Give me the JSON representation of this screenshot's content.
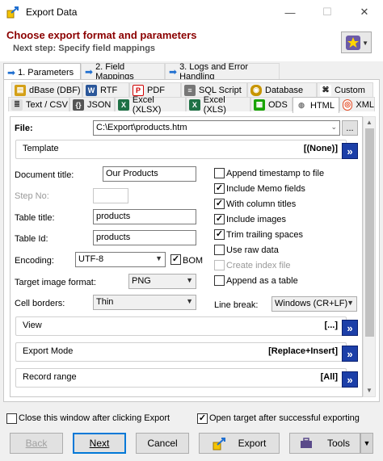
{
  "window": {
    "title": "Export Data",
    "minimize": "—",
    "maximize": "☐",
    "close": "✕"
  },
  "header": {
    "title": "Choose export format and parameters",
    "subtitle": "Next step: Specify field mappings"
  },
  "main_tabs": [
    {
      "label": "1. Parameters"
    },
    {
      "label": "2. Field Mappings"
    },
    {
      "label": "3. Logs and Error Handling"
    }
  ],
  "format_tabs_row1": [
    "dBase (DBF)",
    "RTF",
    "PDF",
    "SQL Script",
    "Database",
    "Custom"
  ],
  "format_tabs_row2": [
    "Text / CSV",
    "JSON",
    "Excel (XLSX)",
    "Excel (XLS)",
    "ODS",
    "HTML",
    "XML"
  ],
  "file": {
    "label": "File:",
    "value": "C:\\Export\\products.htm",
    "browse": "..."
  },
  "template": {
    "label": "Template",
    "value": "[(None)]"
  },
  "fields": {
    "document_title": {
      "label": "Document title:",
      "value": "Our Products"
    },
    "step_no": {
      "label": "Step No:",
      "value": ""
    },
    "table_title": {
      "label": "Table title:",
      "value": "products"
    },
    "table_id": {
      "label": "Table Id:",
      "value": "products"
    },
    "encoding": {
      "label": "Encoding:",
      "value": "UTF-8",
      "bom_label": "BOM"
    },
    "target_image_format": {
      "label": "Target image format:",
      "value": "PNG"
    },
    "cell_borders": {
      "label": "Cell borders:",
      "value": "Thin"
    },
    "line_break": {
      "label": "Line break:",
      "value": "Windows (CR+LF)"
    }
  },
  "options": [
    {
      "label": "Append timestamp to file",
      "checked": false,
      "enabled": true
    },
    {
      "label": "Include Memo fields",
      "checked": true,
      "enabled": true
    },
    {
      "label": "With column titles",
      "checked": true,
      "enabled": true
    },
    {
      "label": "Include images",
      "checked": true,
      "enabled": true
    },
    {
      "label": "Trim trailing spaces",
      "checked": true,
      "enabled": true
    },
    {
      "label": "Use raw data",
      "checked": false,
      "enabled": true
    },
    {
      "label": "Create index file",
      "checked": false,
      "enabled": false
    },
    {
      "label": "Append as a table",
      "checked": false,
      "enabled": true
    }
  ],
  "groups": {
    "view": {
      "label": "View",
      "value": "[...]"
    },
    "export_mode": {
      "label": "Export Mode",
      "value": "[Replace+Insert]"
    },
    "record_range": {
      "label": "Record range",
      "value": "[All]"
    }
  },
  "bottom": {
    "close_after": "Close this window after clicking Export",
    "open_target": "Open target after successful exporting"
  },
  "buttons": {
    "back": "Back",
    "next": "Next",
    "cancel": "Cancel",
    "export": "Export",
    "tools": "Tools"
  },
  "check_mark": "✓",
  "expand_glyph": "»",
  "dropdown_glyph": "▼",
  "colors": {
    "header_title": "#8b0000",
    "expand_button": "#1c3fa8",
    "accent": "#0078d7"
  }
}
